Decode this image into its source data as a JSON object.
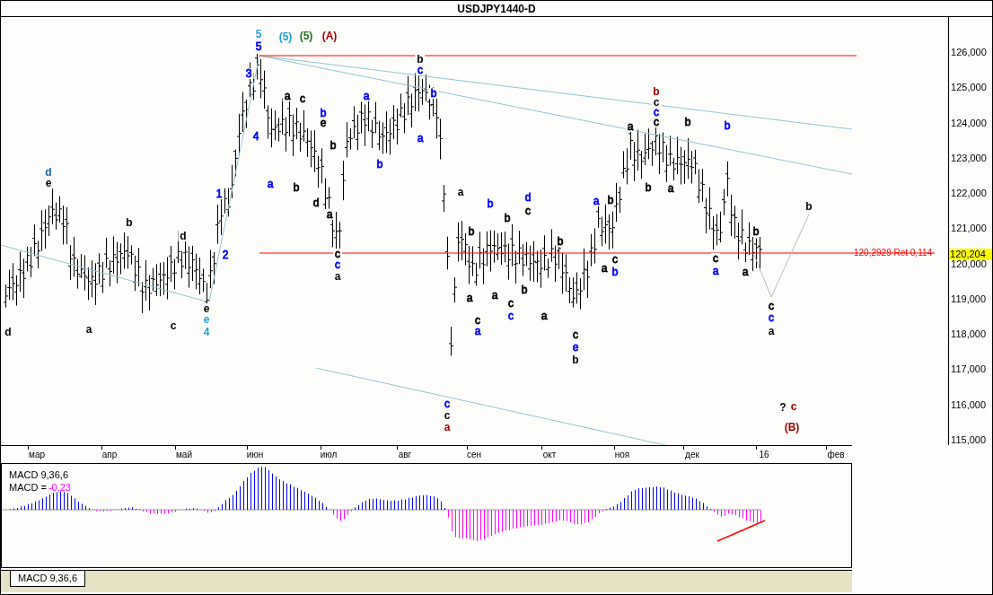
{
  "window": {
    "title": "USDJPY1440-D"
  },
  "price_axis": {
    "ticks": [
      "126,000",
      "125,000",
      "124,000",
      "123,000",
      "122,000",
      "121,000",
      "120,000",
      "119,000",
      "118,000",
      "117,000",
      "116,000",
      "115,000"
    ],
    "current_price": "120,204"
  },
  "levels": [
    {
      "label": "120,2929 Ret 0,114"
    }
  ],
  "time_axis": {
    "labels": [
      "мар",
      "апр",
      "май",
      "июн",
      "июл",
      "авг",
      "сен",
      "окт",
      "ноя",
      "дек",
      "16",
      "фев"
    ]
  },
  "wave_labels": [
    {
      "text": "5",
      "color": "#1ba1d6",
      "bold": true
    },
    {
      "text": "5",
      "color": "#0000ff",
      "bold": false
    },
    {
      "text": "(5)",
      "color": "#1ba1d6",
      "bold": true
    },
    {
      "text": "(5)",
      "color": "#1f6f1f",
      "bold": true
    },
    {
      "text": "(A)",
      "color": "#a00000",
      "bold": true
    },
    {
      "text": "3",
      "color": "#0000ff",
      "bold": false
    },
    {
      "text": "4",
      "color": "#0000ff",
      "bold": false
    },
    {
      "text": "1",
      "color": "#0000ff",
      "bold": false
    },
    {
      "text": "2",
      "color": "#0000ff",
      "bold": false
    },
    {
      "text": "a",
      "color": "#000000",
      "bold": false
    },
    {
      "text": "c",
      "color": "#000000",
      "bold": false
    },
    {
      "text": "b",
      "color": "#0000ff",
      "bold": false
    },
    {
      "text": "e",
      "color": "#000000",
      "bold": false
    },
    {
      "text": "b",
      "color": "#000000",
      "bold": false
    },
    {
      "text": "a",
      "color": "#0000ff",
      "bold": false
    },
    {
      "text": "b",
      "color": "#000000",
      "bold": false
    },
    {
      "text": "d",
      "color": "#000000",
      "bold": false
    },
    {
      "text": "a",
      "color": "#000000",
      "bold": false
    },
    {
      "text": "c",
      "color": "#000000",
      "bold": false
    },
    {
      "text": "c",
      "color": "#0000ff",
      "bold": false
    },
    {
      "text": "a",
      "color": "#000000",
      "bold": true
    },
    {
      "text": "a",
      "color": "#0000ff",
      "bold": false
    },
    {
      "text": "b",
      "color": "#0000ff",
      "bold": false
    },
    {
      "text": "b",
      "color": "#000000",
      "bold": true
    },
    {
      "text": "c",
      "color": "#0000ff",
      "bold": false
    },
    {
      "text": "b",
      "color": "#0000ff",
      "bold": false
    },
    {
      "text": "a",
      "color": "#0000ff",
      "bold": false
    },
    {
      "text": "d",
      "color": "#1560a0",
      "bold": true
    },
    {
      "text": "e",
      "color": "#000000",
      "bold": true
    },
    {
      "text": "b",
      "color": "#000000",
      "bold": true
    },
    {
      "text": "d",
      "color": "#000000",
      "bold": true
    },
    {
      "text": "d",
      "color": "#000000",
      "bold": true
    },
    {
      "text": "a",
      "color": "#000000",
      "bold": true
    },
    {
      "text": "c",
      "color": "#000000",
      "bold": true
    },
    {
      "text": "e",
      "color": "#000000",
      "bold": true
    },
    {
      "text": "e",
      "color": "#1ba1d6",
      "bold": true
    },
    {
      "text": "4",
      "color": "#1ba1d6",
      "bold": true
    },
    {
      "text": "a",
      "color": "#000000",
      "bold": true
    },
    {
      "text": "b",
      "color": "#0000ff",
      "bold": false
    },
    {
      "text": "b",
      "color": "#000000",
      "bold": false
    },
    {
      "text": "d",
      "color": "#0000ff",
      "bold": false
    },
    {
      "text": "c",
      "color": "#000000",
      "bold": false
    },
    {
      "text": "a",
      "color": "#0000ff",
      "bold": false
    },
    {
      "text": "b",
      "color": "#000000",
      "bold": false
    },
    {
      "text": "b",
      "color": "#000000",
      "bold": false
    },
    {
      "text": "a",
      "color": "#000000",
      "bold": false
    },
    {
      "text": "c",
      "color": "#000000",
      "bold": false
    },
    {
      "text": "a",
      "color": "#0000ff",
      "bold": false
    },
    {
      "text": "a",
      "color": "#000000",
      "bold": false
    },
    {
      "text": "c",
      "color": "#000000",
      "bold": false
    },
    {
      "text": "c",
      "color": "#0000ff",
      "bold": false
    },
    {
      "text": "b",
      "color": "#000000",
      "bold": false
    },
    {
      "text": "c",
      "color": "#0000ff",
      "bold": false
    },
    {
      "text": "c",
      "color": "#000000",
      "bold": true
    },
    {
      "text": "a",
      "color": "#a00000",
      "bold": true
    },
    {
      "text": "b",
      "color": "#000000",
      "bold": false
    },
    {
      "text": "a",
      "color": "#000000",
      "bold": false
    },
    {
      "text": "c",
      "color": "#000000",
      "bold": false
    },
    {
      "text": "e",
      "color": "#0000ff",
      "bold": false
    },
    {
      "text": "b",
      "color": "#000000",
      "bold": true
    },
    {
      "text": "a",
      "color": "#000000",
      "bold": false
    },
    {
      "text": "c",
      "color": "#000000",
      "bold": false
    },
    {
      "text": "b",
      "color": "#0000ff",
      "bold": false
    },
    {
      "text": "b",
      "color": "#a00000",
      "bold": true
    },
    {
      "text": "c",
      "color": "#000000",
      "bold": true
    },
    {
      "text": "c",
      "color": "#0000ff",
      "bold": false
    },
    {
      "text": "c",
      "color": "#000000",
      "bold": false
    },
    {
      "text": "a",
      "color": "#000000",
      "bold": false
    },
    {
      "text": "b",
      "color": "#000000",
      "bold": false
    },
    {
      "text": "b",
      "color": "#000000",
      "bold": false
    },
    {
      "text": "a",
      "color": "#000000",
      "bold": false
    },
    {
      "text": "b",
      "color": "#0000ff",
      "bold": false
    },
    {
      "text": "c",
      "color": "#000000",
      "bold": false
    },
    {
      "text": "a",
      "color": "#0000ff",
      "bold": false
    },
    {
      "text": "a",
      "color": "#000000",
      "bold": false
    },
    {
      "text": "b",
      "color": "#000000",
      "bold": false
    },
    {
      "text": "b",
      "color": "#000000",
      "bold": true
    },
    {
      "text": "c",
      "color": "#000000",
      "bold": false
    },
    {
      "text": "c",
      "color": "#0000ff",
      "bold": false
    },
    {
      "text": "a",
      "color": "#000000",
      "bold": true
    },
    {
      "text": "?",
      "color": "#000000",
      "bold": true
    },
    {
      "text": "c",
      "color": "#a00000",
      "bold": true
    },
    {
      "text": "(B)",
      "color": "#a00000",
      "bold": true
    }
  ],
  "macd": {
    "title": "MACD 9,36,6",
    "value_label": "MACD =",
    "value": "-0,23"
  },
  "tabs": [
    {
      "label": "MACD 9,36,6",
      "selected": true
    }
  ]
}
